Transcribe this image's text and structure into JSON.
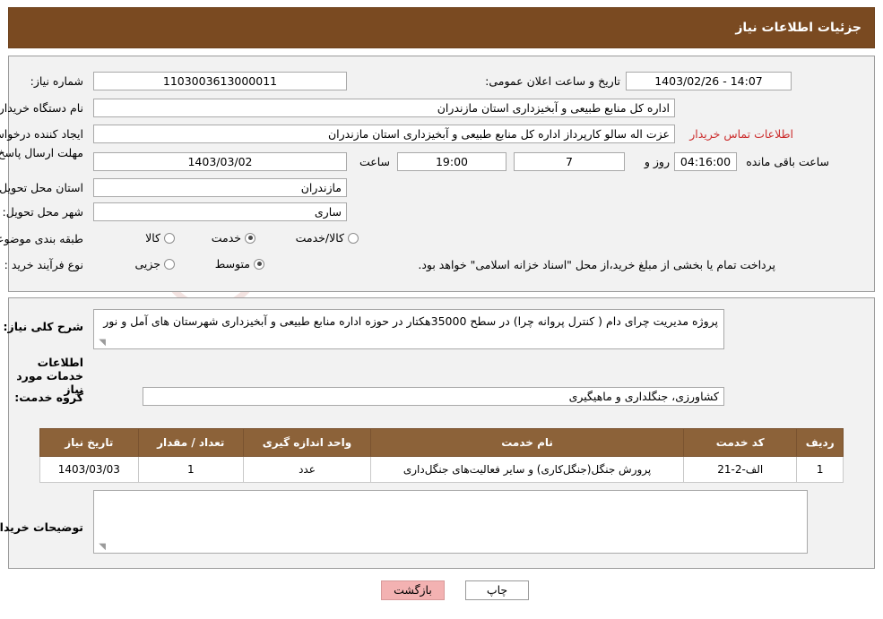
{
  "header": {
    "title": "جزئیات اطلاعات نیاز"
  },
  "watermark": {
    "text": "iranTender.net"
  },
  "form": {
    "need_number_label": "شماره نیاز:",
    "need_number_value": "1103003613000011",
    "announce_datetime_label": "تاریخ و ساعت اعلان عمومی:",
    "announce_datetime_value": "14:07 - 1403/02/26",
    "buyer_org_label": "نام دستگاه خریدار:",
    "buyer_org_value": "اداره کل منابع طبیعی و آبخیزداری استان مازندران",
    "requester_label": "ایجاد کننده درخواست:",
    "requester_value": "عزت اله سالو کارپرداز اداره کل منابع طبیعی و آبخیزداری استان مازندران",
    "contact_link": "اطلاعات تماس خریدار",
    "deadline_label": "مهلت ارسال پاسخ: تا تاریخ:",
    "deadline_date": "1403/03/02",
    "hour_label": "ساعت",
    "deadline_time": "19:00",
    "days_value": "7",
    "days_label": "روز و",
    "remaining_time": "04:16:00",
    "remaining_label": "ساعت باقی مانده",
    "province_label": "استان محل تحویل:",
    "province_value": "مازندران",
    "city_label": "شهر محل تحویل:",
    "city_value": "ساری",
    "category_label": "طبقه بندی موضوعی:",
    "category_options": [
      {
        "label": "کالا",
        "checked": false
      },
      {
        "label": "خدمت",
        "checked": true
      },
      {
        "label": "کالا/خدمت",
        "checked": false
      }
    ],
    "purchase_type_label": "نوع فرآیند خرید :",
    "purchase_type_options": [
      {
        "label": "جزیی",
        "checked": false
      },
      {
        "label": "متوسط",
        "checked": true
      }
    ],
    "payment_note": "پرداخت تمام یا بخشی از مبلغ خرید،از محل \"اسناد خزانه اسلامی\" خواهد بود."
  },
  "detail": {
    "summary_label": "شرح کلی نیاز:",
    "summary_value": "پروژه مدیریت چرای دام ( کنترل پروانه چرا) در سطح 35000هکتار در حوزه اداره منابع طبیعی و آبخیزداری شهرستان های آمل و نور",
    "services_title": "اطلاعات خدمات مورد نیاز",
    "service_group_label": "گروه خدمت:",
    "service_group_value": "کشاورزی، جنگلداری و ماهیگیری",
    "table": {
      "headers": [
        "ردیف",
        "کد خدمت",
        "نام خدمت",
        "واحد اندازه گیری",
        "تعداد / مقدار",
        "تاریخ نیاز"
      ],
      "rows": [
        [
          "1",
          "الف-2-21",
          "پرورش جنگل(جنگل‌کاری) و سایر فعالیت‌های جنگل‌داری",
          "عدد",
          "1",
          "1403/03/03"
        ]
      ]
    },
    "buyer_notes_label": "توضیحات خریدار;",
    "buyer_notes_value": ""
  },
  "footer": {
    "print_label": "چاپ",
    "back_label": "بازگشت"
  }
}
